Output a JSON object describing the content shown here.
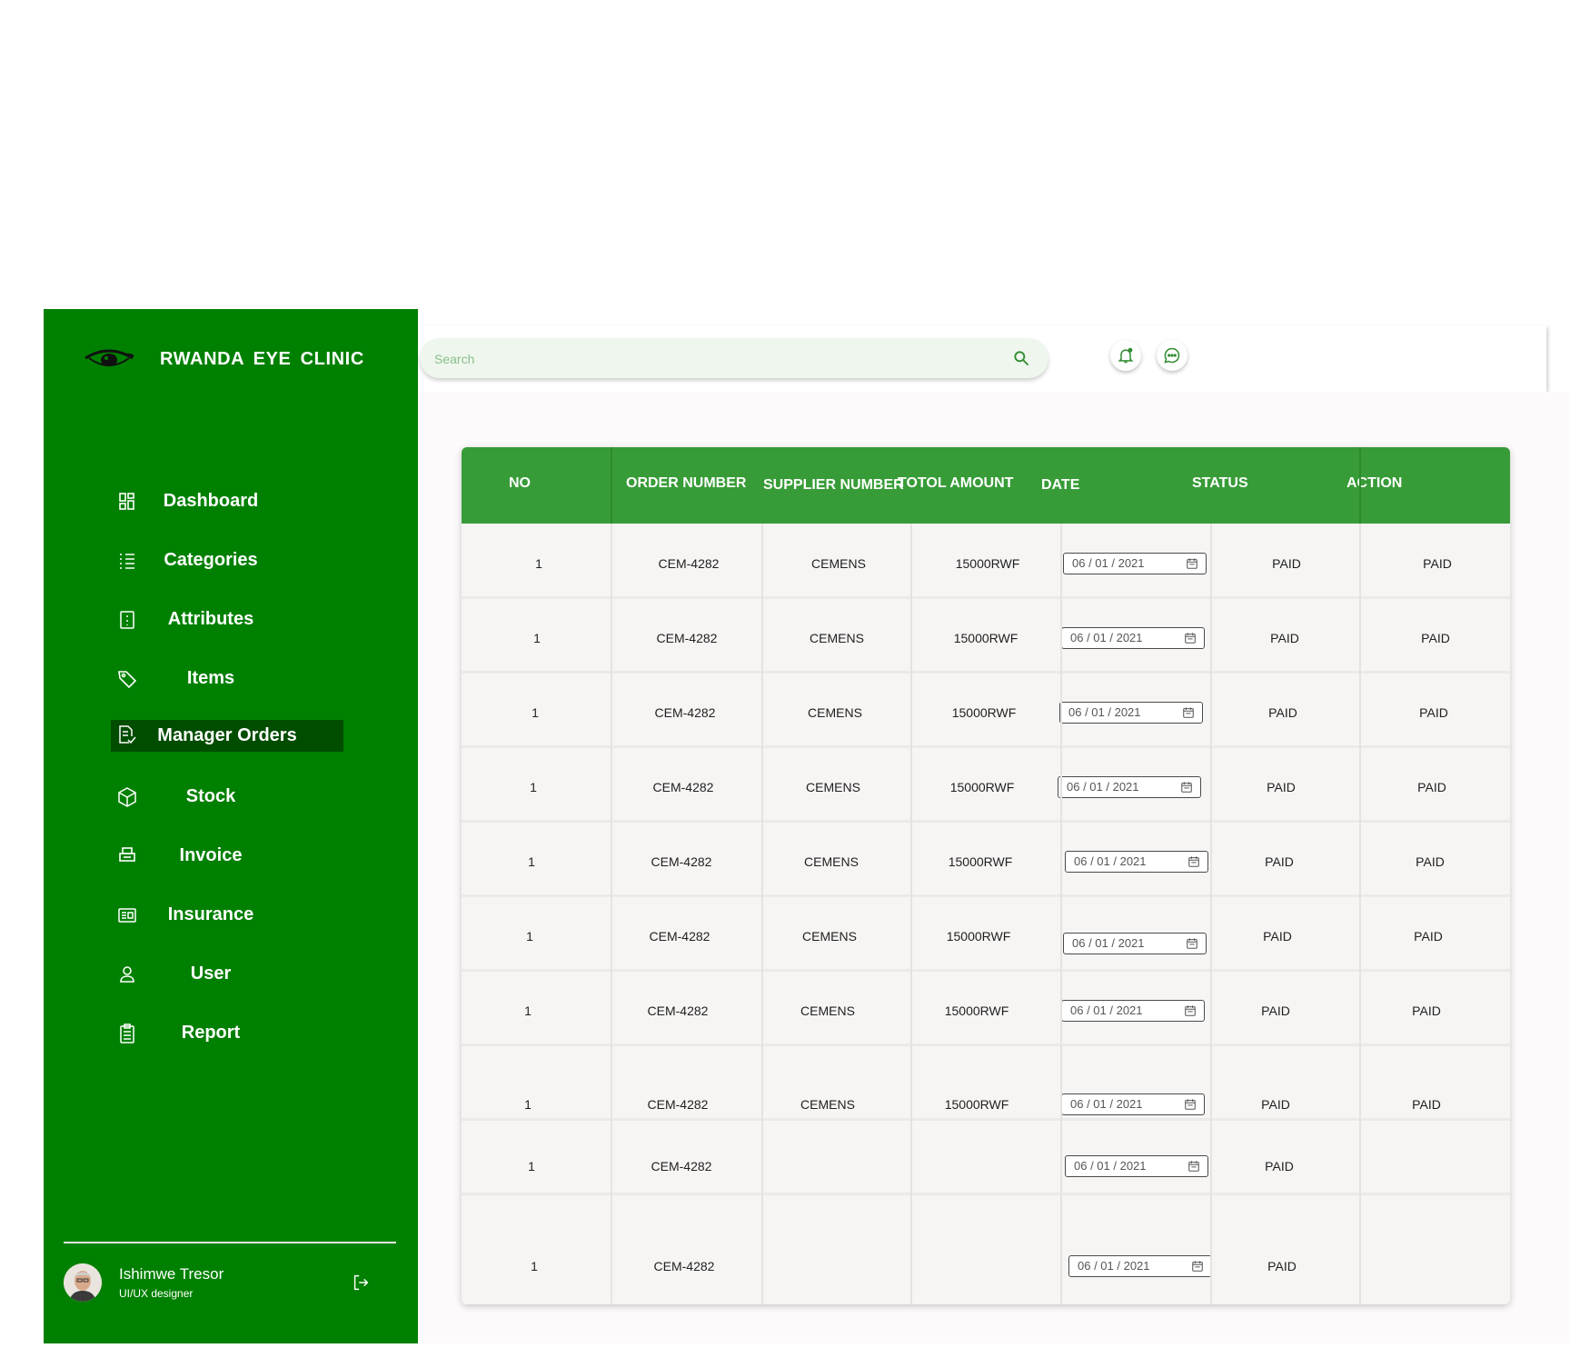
{
  "app": {
    "title": "RWANDA  EYE  CLINIC"
  },
  "colors": {
    "sidebar": "#008000",
    "active": "#004d00",
    "table_header": "#379c37"
  },
  "sidebar": {
    "items": [
      {
        "label": "Dashboard",
        "icon": "dashboard-icon"
      },
      {
        "label": "Categories",
        "icon": "list-icon"
      },
      {
        "label": "Attributes",
        "icon": "attributes-icon"
      },
      {
        "label": "Items",
        "icon": "tag-icon"
      },
      {
        "label": "Manager Orders",
        "icon": "orders-icon",
        "active": true
      },
      {
        "label": "Stock",
        "icon": "box-icon"
      },
      {
        "label": "Invoice",
        "icon": "printer-icon"
      },
      {
        "label": "Insurance",
        "icon": "card-icon"
      },
      {
        "label": "User",
        "icon": "user-icon"
      },
      {
        "label": "Report",
        "icon": "clipboard-icon"
      }
    ]
  },
  "profile": {
    "name": "Ishimwe Tresor",
    "role": "UI/UX designer"
  },
  "search": {
    "placeholder": "Search"
  },
  "table": {
    "columns": [
      "NO",
      "ORDER NUMBER",
      "SUPPLIER  NUMBER",
      "TOTOL AMOUNT",
      "DATE",
      "STATUS",
      "ACTION"
    ],
    "rows": [
      {
        "no": "1",
        "order": "CEM-4282",
        "supplier": "CEMENS",
        "amount": "15000RWF",
        "date": "06 / 01 / 2021",
        "status": "PAID",
        "action": "PAID"
      },
      {
        "no": "1",
        "order": "CEM-4282",
        "supplier": "CEMENS",
        "amount": "15000RWF",
        "date": "06 / 01 / 2021",
        "status": "PAID",
        "action": "PAID"
      },
      {
        "no": "1",
        "order": "CEM-4282",
        "supplier": "CEMENS",
        "amount": "15000RWF",
        "date": "06 / 01 / 2021",
        "status": "PAID",
        "action": "PAID"
      },
      {
        "no": "1",
        "order": "CEM-4282",
        "supplier": "CEMENS",
        "amount": "15000RWF",
        "date": "06 / 01 / 2021",
        "status": "PAID",
        "action": "PAID"
      },
      {
        "no": "1",
        "order": "CEM-4282",
        "supplier": "CEMENS",
        "amount": "15000RWF",
        "date": "06 / 01 / 2021",
        "status": "PAID",
        "action": "PAID"
      },
      {
        "no": "1",
        "order": "CEM-4282",
        "supplier": "CEMENS",
        "amount": "15000RWF",
        "date": "06 / 01 / 2021",
        "status": "PAID",
        "action": "PAID"
      },
      {
        "no": "1",
        "order": "CEM-4282",
        "supplier": "CEMENS",
        "amount": "15000RWF",
        "date": "06 / 01 / 2021",
        "status": "PAID",
        "action": "PAID"
      },
      {
        "no": "1",
        "order": "CEM-4282",
        "supplier": "CEMENS",
        "amount": "15000RWF",
        "date": "06 / 01 / 2021",
        "status": "PAID",
        "action": "PAID"
      },
      {
        "no": "1",
        "order": "CEM-4282",
        "supplier": "",
        "amount": "",
        "date": "06 / 01 / 2021",
        "status": "PAID",
        "action": ""
      },
      {
        "no": "1",
        "order": "CEM-4282",
        "supplier": "",
        "amount": "",
        "date": "06 / 01 / 2021",
        "status": "PAID",
        "action": ""
      }
    ]
  }
}
